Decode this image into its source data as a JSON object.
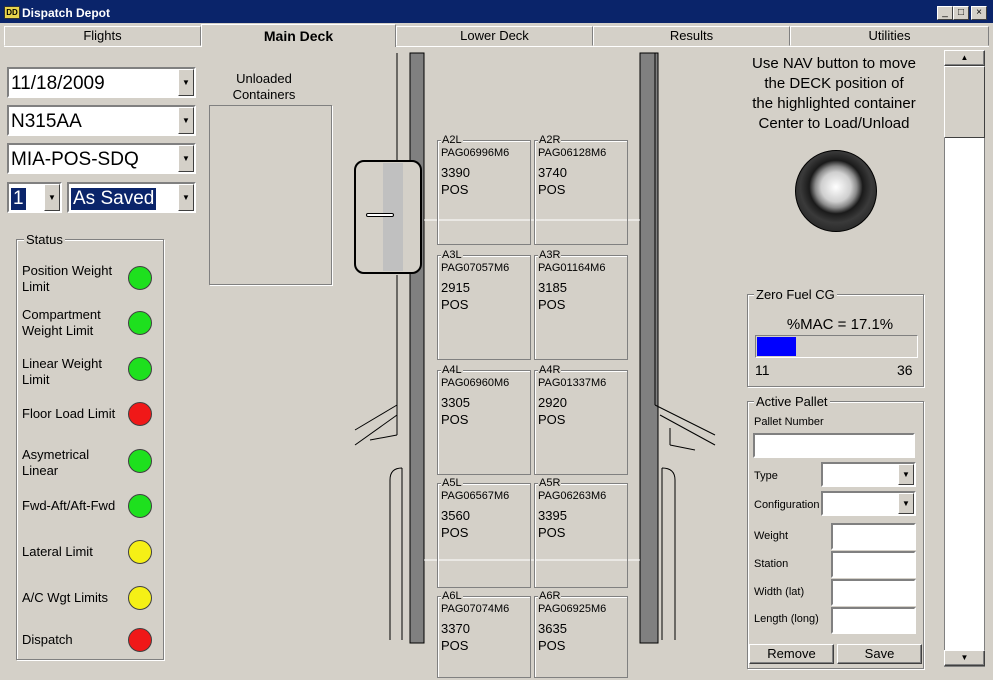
{
  "window": {
    "title": "Dispatch Depot",
    "icon_text": "DD",
    "minimize": "_",
    "maximize": "□",
    "close": "×"
  },
  "tabs": [
    "Flights",
    "Main Deck",
    "Lower Deck",
    "Results",
    "Utilities"
  ],
  "flight": {
    "date": "11/18/2009",
    "tail": "N315AA",
    "route": "MIA-POS-SDQ",
    "version": "1",
    "mode": "As Saved"
  },
  "unloaded": {
    "label": "Unloaded Containers"
  },
  "status": {
    "title": "Status",
    "items": [
      {
        "label": "Position Weight Limit",
        "color": "#1ee01e"
      },
      {
        "label": "Compartment Weight Limit",
        "color": "#1ee01e"
      },
      {
        "label": "Linear Weight Limit",
        "color": "#1ee01e"
      },
      {
        "label": "Floor Load Limit",
        "color": "#f01818"
      },
      {
        "label": "Asymetrical Linear",
        "color": "#1ee01e"
      },
      {
        "label": "Fwd-Aft/Aft-Fwd",
        "color": "#1ee01e"
      },
      {
        "label": "Lateral Limit",
        "color": "#f5f016"
      },
      {
        "label": "A/C Wgt Limits",
        "color": "#f5f016"
      },
      {
        "label": "Dispatch",
        "color": "#f01818"
      }
    ]
  },
  "positions": [
    {
      "code": "A2L",
      "pallet": "PAG06996M6",
      "weight": "3390",
      "dest": "POS"
    },
    {
      "code": "A2R",
      "pallet": "PAG06128M6",
      "weight": "3740",
      "dest": "POS"
    },
    {
      "code": "A3L",
      "pallet": "PAG07057M6",
      "weight": "2915",
      "dest": "POS"
    },
    {
      "code": "A3R",
      "pallet": "PAG01164M6",
      "weight": "3185",
      "dest": "POS"
    },
    {
      "code": "A4L",
      "pallet": "PAG06960M6",
      "weight": "3305",
      "dest": "POS"
    },
    {
      "code": "A4R",
      "pallet": "PAG01337M6",
      "weight": "2920",
      "dest": "POS"
    },
    {
      "code": "A5L",
      "pallet": "PAG06567M6",
      "weight": "3560",
      "dest": "POS"
    },
    {
      "code": "A5R",
      "pallet": "PAG06263M6",
      "weight": "3395",
      "dest": "POS"
    },
    {
      "code": "A6L",
      "pallet": "PAG07074M6",
      "weight": "3370",
      "dest": "POS"
    },
    {
      "code": "A6R",
      "pallet": "PAG06925M6",
      "weight": "3635",
      "dest": "POS"
    }
  ],
  "nav": {
    "instructions": [
      "Use NAV button to move",
      "the DECK position of",
      "the highlighted container",
      "Center to Load/Unload"
    ]
  },
  "zfcg": {
    "title": "Zero Fuel CG",
    "readout": "%MAC = 17.1%",
    "min": "11",
    "max": "36",
    "value": 17.1
  },
  "active_pallet": {
    "title": "Active Pallet",
    "pallet_number_label": "Pallet Number",
    "pallet_number": "",
    "type_label": "Type",
    "type_value": "",
    "config_label": "Configuration",
    "config_value": "",
    "weight_label": "Weight",
    "station_label": "Station",
    "width_label": "Width (lat)",
    "length_label": "Length (long)",
    "weight": "",
    "station": "",
    "width": "",
    "length": "",
    "remove_label": "Remove",
    "save_label": "Save"
  },
  "scrollbar": {
    "up": "▲",
    "down": "▼"
  }
}
